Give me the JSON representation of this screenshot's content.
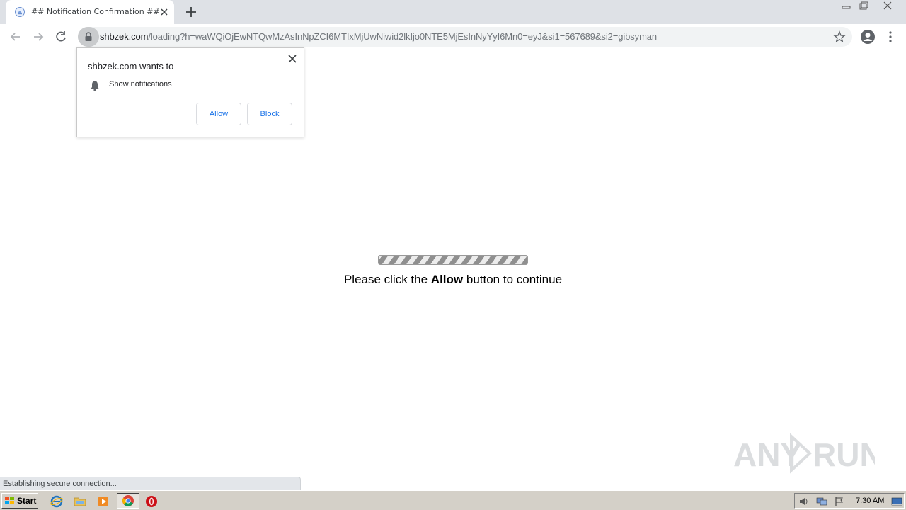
{
  "browser": {
    "tab": {
      "title": "## Notification Confirmation ##",
      "favicon": "globe-bell-icon"
    },
    "new_tab_icon": "plus-icon",
    "window_controls": [
      "minimize-icon",
      "restore-icon",
      "close-icon"
    ],
    "toolbar": {
      "back_icon": "back-arrow-icon",
      "forward_icon": "forward-arrow-icon",
      "reload_icon": "reload-icon",
      "url_host": "shbzek.com",
      "url_path": "/loading?h=waWQiOjEwNTQwMzAsInNpZCI6MTIxMjUwNiwid2lkIjo0NTE5MjEsInNyYyI6Mn0=eyJ&si1=567689&si2=gibsyman",
      "bookmark_icon": "star-icon",
      "profile_icon": "account-icon",
      "menu_icon": "kebab-menu-icon"
    }
  },
  "permission_popup": {
    "title": "shbzek.com wants to",
    "permission": "Show notifications",
    "allow_label": "Allow",
    "block_label": "Block"
  },
  "page": {
    "message_before": "Please click the ",
    "message_bold": "Allow",
    "message_after": " button to continue"
  },
  "status_bar": {
    "text": "Establishing secure connection..."
  },
  "watermark": {
    "text": "ANY RUN"
  },
  "taskbar": {
    "start_label": "Start",
    "quick_launch": [
      "ie-icon",
      "folder-icon",
      "media-player-icon",
      "chrome-icon",
      "opera-icon"
    ],
    "tray_icons": [
      "volume-icon",
      "network-icon",
      "flag-icon"
    ],
    "clock": "7:30 AM"
  },
  "colors": {
    "accent": "#1a73e8",
    "tabstrip": "#dee1e6",
    "taskbar": "#d4d0c8"
  }
}
